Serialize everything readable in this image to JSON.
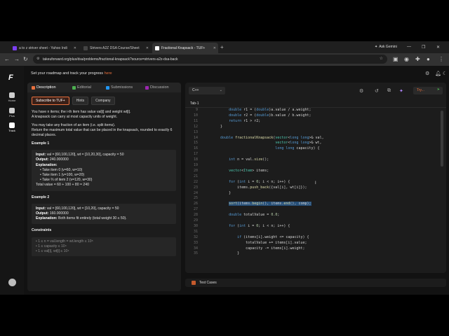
{
  "browser": {
    "tabs": [
      {
        "title": "a to z striver sheet - Yahoo Indi",
        "color": "#7b3ff2",
        "active": false
      },
      {
        "title": "Strivers A2Z DSA Course/Sheet",
        "color": "#2a2a2a",
        "active": false
      },
      {
        "title": "Fractional Knapsack - TUF+",
        "color": "#ffffff",
        "active": true
      }
    ],
    "gemini_label": "Ask Gemini",
    "url": "takeuforward.org/plus/dsa/problems/fractional-knapsack?source=strivers-a2z-dsa-back"
  },
  "app": {
    "nav": [
      {
        "label": "Home"
      },
      {
        "label": "Plus"
      },
      {
        "label": "Track"
      }
    ],
    "header_text": "Set your roadmap and track your progress ",
    "header_link": "here"
  },
  "problem": {
    "tabs": [
      {
        "label": "Description",
        "color": "#e9703e"
      },
      {
        "label": "Editorial",
        "color": "#4caf50"
      },
      {
        "label": "Submissions",
        "color": "#2196f3"
      },
      {
        "label": "Discussion",
        "color": "#9c27b0"
      }
    ],
    "subscribe": "Subscribe to TUF+",
    "hints": "Hints",
    "company": "Company",
    "para1_a": "You have n items; the i-th item has value val[i] and weight wt[i].",
    "para1_b": "A knapsack can carry at most capacity units of weight.",
    "para2_a": "You may take any fraction of an item (i.e. split items).",
    "para2_b": "Return the maximum total value that can be placed in the knapsack, rounded to exactly 6 decimal places.",
    "ex1": {
      "title": "Example 1",
      "input_label": "Input:",
      "input": "val = [60,100,120], wt = [10,20,30], capacity = 50",
      "output_label": "Output:",
      "output": "240.000000",
      "explanation_label": "Explanation:",
      "steps": [
        "Take item 0 (v=60, w=10)",
        "Take item 1 (v=100, w=20)",
        "Take ⅔ of item 2 (v=120, w=30)"
      ],
      "total": "Total value = 60 + 100 + 80 = 240"
    },
    "ex2": {
      "title": "Example 2",
      "input_label": "Input:",
      "input": "val = [60,100,120], wt = [10,20], capacity = 50",
      "output_label": "Output:",
      "output": "160.000000",
      "explanation_label": "Explanation:",
      "explanation": "Both items fit entirely (total weight 30 ≤ 50)."
    },
    "constraints_title": "Constraints",
    "constraints": [
      "1 ≤ n = val.length = wt.length ≤ 10⁵",
      "1 ≤ capacity ≤ 10⁹",
      "1 ≤ val[i], wt[i] ≤ 10⁴"
    ]
  },
  "editor": {
    "language": "C++",
    "run_label": "Try...",
    "tab": "Tab-1",
    "lines": [
      {
        "n": "9",
        "code": "        double r1 = (double)a.value / a.weight;"
      },
      {
        "n": "10",
        "code": "        double r2 = (double)b.value / b.weight;"
      },
      {
        "n": "11",
        "code": "        return r1 > r2;"
      },
      {
        "n": "12",
        "code": "    }"
      },
      {
        "n": "13",
        "code": ""
      },
      {
        "n": "14",
        "code": "    double fractionalKnapsack(vector<long long>& val,"
      },
      {
        "n": "15",
        "code": "                              vector<long long>& wt,"
      },
      {
        "n": "16",
        "code": "                              long long capacity) {"
      },
      {
        "n": "17",
        "code": ""
      },
      {
        "n": "18",
        "code": "        int n = val.size();"
      },
      {
        "n": "19",
        "code": ""
      },
      {
        "n": "20",
        "code": "        vector<Item> items;"
      },
      {
        "n": "21",
        "code": ""
      },
      {
        "n": "22",
        "code": "        for (int i = 0; i < n; i++) {"
      },
      {
        "n": "23",
        "code": "            items.push_back({val[i], wt[i]});"
      },
      {
        "n": "24",
        "code": "        }"
      },
      {
        "n": "25",
        "code": ""
      },
      {
        "n": "26",
        "code": "        sort(items.begin(), items.end(), comp);"
      },
      {
        "n": "27",
        "code": ""
      },
      {
        "n": "28",
        "code": "        double totalValue = 0.0;"
      },
      {
        "n": "29",
        "code": ""
      },
      {
        "n": "30",
        "code": "        for (int i = 0; i < n; i++) {"
      },
      {
        "n": "31",
        "code": ""
      },
      {
        "n": "32",
        "code": "            if (items[i].weight <= capacity) {"
      },
      {
        "n": "33",
        "code": "                totalValue += items[i].value;"
      },
      {
        "n": "34",
        "code": "                capacity -= items[i].weight;"
      },
      {
        "n": "35",
        "code": "            }"
      }
    ],
    "highlight_line": "26",
    "test_cases": "Test Cases"
  },
  "colors": {
    "accent": "#e9703e",
    "selection": "#264f78"
  }
}
